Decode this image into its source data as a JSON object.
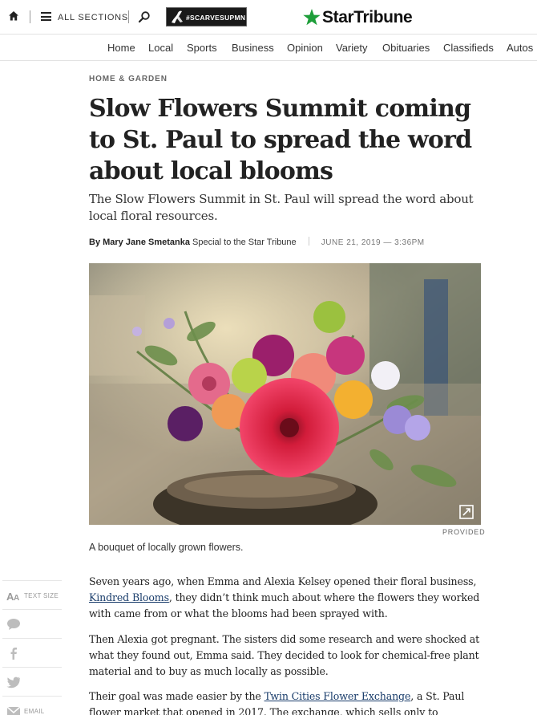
{
  "header": {
    "sections_label": "ALL SECTIONS",
    "promo_tag": "#SCARVESUPMN",
    "logo_text": "StarTribune",
    "brand_color": "#1e9e3a",
    "icons": [
      "home-icon",
      "menu-icon",
      "search-icon"
    ]
  },
  "nav": {
    "items": [
      "Home",
      "Local",
      "Sports",
      "Business",
      "Opinion",
      "Variety",
      "Obituaries",
      "Classifieds",
      "Autos"
    ]
  },
  "article": {
    "kicker": "HOME & GARDEN",
    "headline": "Slow Flowers Summit coming to St. Paul to spread the word about local blooms",
    "dek": "The Slow Flowers Summit in St. Paul will spread the word about local floral resources.",
    "byline_prefix": "By",
    "author": "Mary Jane Smetanka",
    "author_role": "Special to the Star Tribune",
    "date": "JUNE 21, 2019 — 3:36PM",
    "photo_credit": "PROVIDED",
    "caption": "A bouquet of locally grown flowers.",
    "p1_before": "Seven years ago, when Emma and Alexia Kelsey opened their floral business, ",
    "p1_link": "Kindred Blooms",
    "p1_after": ", they didn’t think much about where the flowers they worked with came from or what the blooms had been sprayed with.",
    "p2": "Then Alexia got pregnant. The sisters did some research and were shocked at what they found out, Emma said. They decided to look for chemical-free plant material and to buy as much locally as possible.",
    "p3_before": "Their goal was made easier by the ",
    "p3_link": "Twin Cities Flower Exchange",
    "p3_after": ", a St. Paul flower market that opened in 2017. The exchange, which sells only to"
  },
  "share_rail": {
    "text_size_label": "TEXT SIZE",
    "email_label": "EMAIL",
    "icons": [
      "text-size-icon",
      "comment-icon",
      "facebook-icon",
      "twitter-icon",
      "email-icon"
    ]
  }
}
